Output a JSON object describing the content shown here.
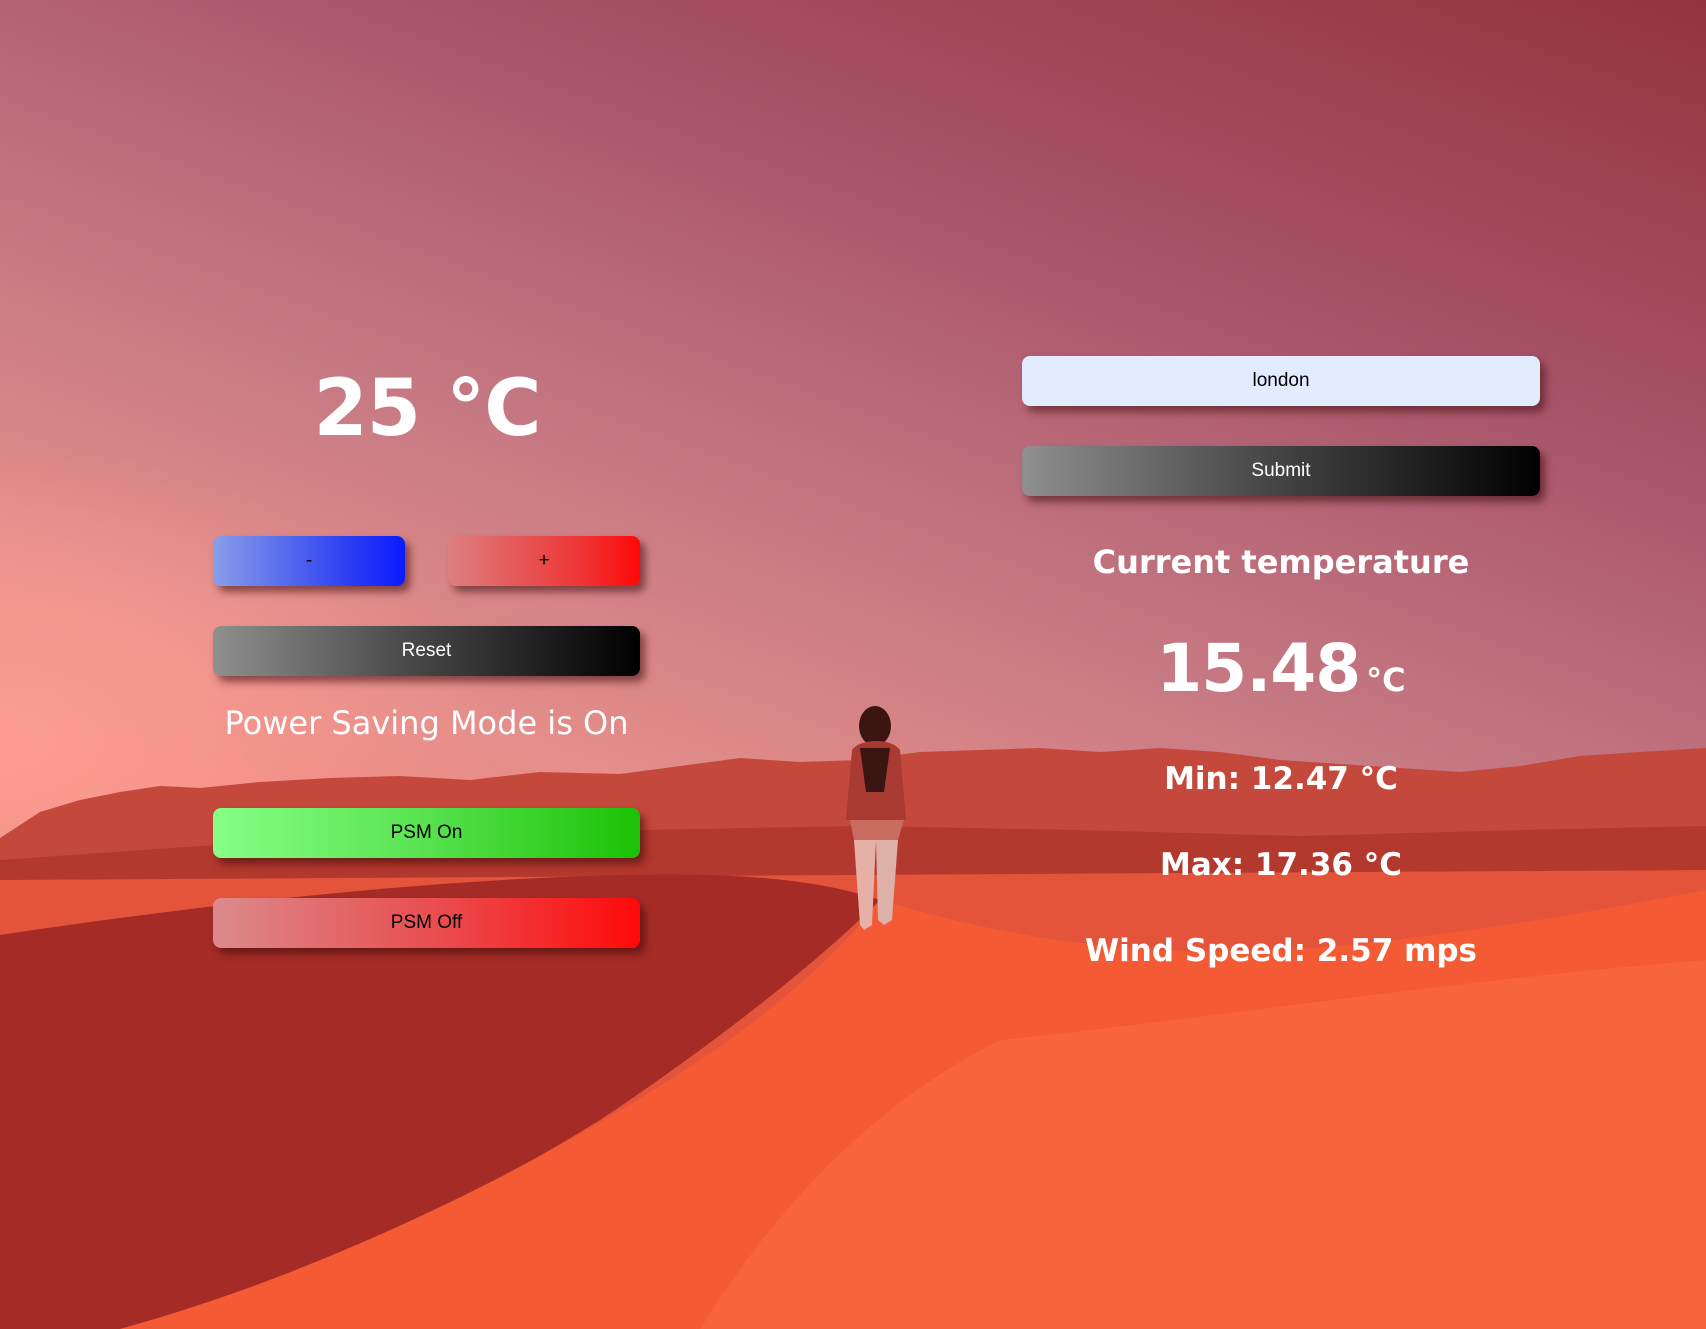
{
  "thermostat": {
    "temperature": "25 °C",
    "minus_label": "-",
    "plus_label": "+",
    "reset_label": "Reset",
    "psm_status": "Power Saving Mode is On",
    "psm_on_label": "PSM On",
    "psm_off_label": "PSM Off"
  },
  "weather": {
    "city_value": "london",
    "submit_label": "Submit",
    "heading": "Current temperature",
    "temperature": "15.48",
    "unit": "°C",
    "min": "Min: 12.47 °C",
    "max": "Max: 17.36 °C",
    "wind": "Wind Speed: 2.57 mps"
  },
  "colors": {
    "minus_button": "#0a1bff",
    "plus_button": "#ff0808",
    "psm_on_button": "#1bc205",
    "psm_off_button": "#ff0909",
    "dark_button": "#000000",
    "input_background": "#e3ecff"
  }
}
